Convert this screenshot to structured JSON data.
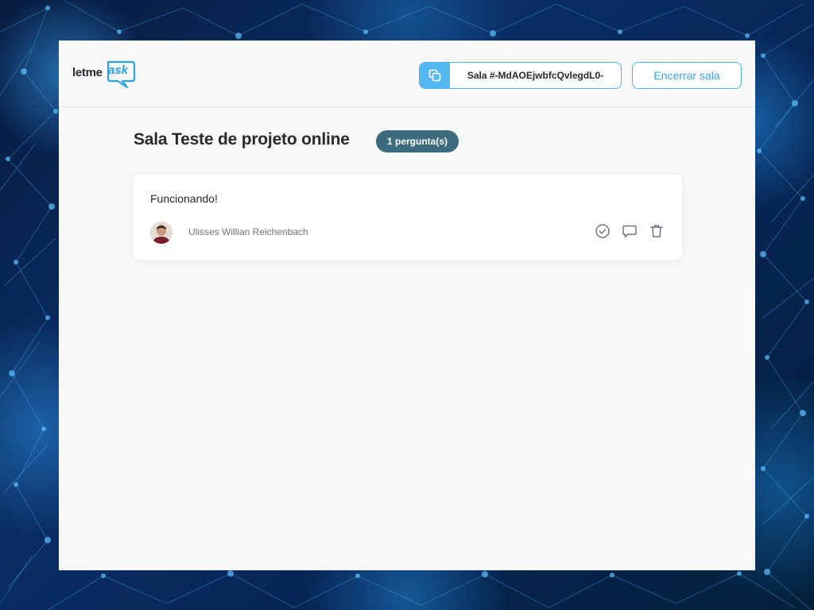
{
  "header": {
    "logo": {
      "text_main": "letme",
      "text_accent": "ask"
    },
    "room_code": {
      "label": "Sala #-MdAOEjwbfcQvlegdL0-"
    },
    "close_room_label": "Encerrar sala"
  },
  "room": {
    "title": "Sala Teste de projeto online",
    "question_count": "1 pergunta(s)"
  },
  "questions": [
    {
      "content": "Funcionando!",
      "author": "Ulisses Willian Reichenbach",
      "actions": [
        "check-circle-icon",
        "answer-icon",
        "trash-icon"
      ]
    }
  ],
  "colors": {
    "accent": "#29a0e8",
    "badge": "#3b6b7d",
    "surface": "#f8f8f8"
  }
}
